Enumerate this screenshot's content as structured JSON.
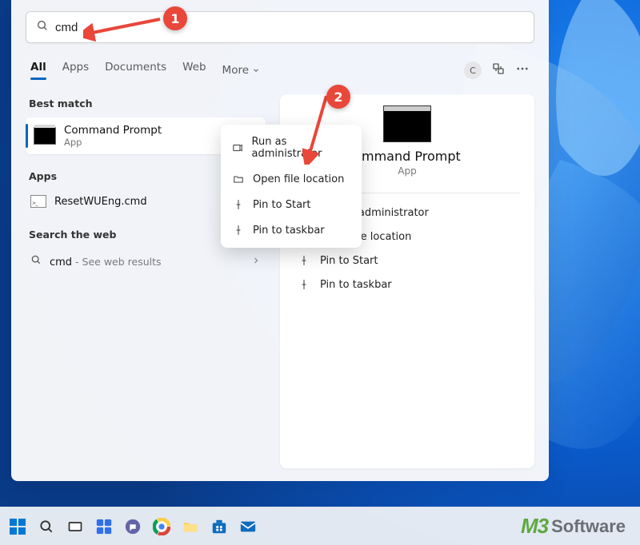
{
  "search": {
    "value": "cmd"
  },
  "tabs": {
    "all": "All",
    "apps": "Apps",
    "documents": "Documents",
    "web": "Web",
    "more": "More"
  },
  "head": {
    "user_initial": "C"
  },
  "left": {
    "best_match_label": "Best match",
    "bestmatch": {
      "title": "Command Prompt",
      "subtitle": "App"
    },
    "apps_label": "Apps",
    "app_item": "ResetWUEng.cmd",
    "web_label": "Search the web",
    "web_item_prefix": "cmd",
    "web_item_suffix": " - See web results"
  },
  "preview": {
    "title": "ommand Prompt",
    "subtitle": "App"
  },
  "actions": {
    "run_admin": "Run as administrator",
    "open_loc": "Open file location",
    "pin_start": "Pin to Start",
    "pin_taskbar": "Pin to taskbar"
  },
  "ctx": {
    "run_admin": "Run as administrator",
    "open_loc": "Open file location",
    "pin_start": "Pin to Start",
    "pin_taskbar": "Pin to taskbar"
  },
  "annotation": {
    "one": "1",
    "two": "2"
  },
  "watermark": {
    "brand": "M3",
    "text": "Software"
  }
}
